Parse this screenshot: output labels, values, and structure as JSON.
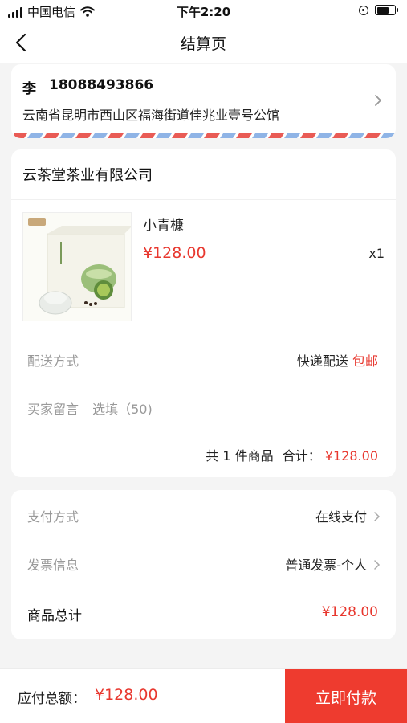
{
  "status_bar": {
    "carrier": "中国电信",
    "time": "下午2:20",
    "battery_level": 0.7
  },
  "nav": {
    "title": "结算页",
    "back_icon": "chevron-left-icon"
  },
  "address": {
    "name": "李",
    "phone": "18088493866",
    "detail": "云南省昆明市西山区福海街道佳兆业壹号公馆"
  },
  "order": {
    "store_name": "云茶堂茶业有限公司",
    "product": {
      "name": "小青槺",
      "price": "¥128.00",
      "quantity": "x1"
    },
    "delivery": {
      "label": "配送方式",
      "method": "快递配送",
      "fee": "包邮"
    },
    "message": {
      "label": "买家留言",
      "placeholder": "选填（50)"
    },
    "summary": {
      "count_text": "共 1 件商品",
      "total_label": "合计：",
      "total_value": "¥128.00"
    }
  },
  "payment": {
    "method_label": "支付方式",
    "method_value": "在线支付",
    "invoice_label": "发票信息",
    "invoice_value": "普通发票-个人",
    "goods_total_label": "商品总计",
    "goods_total_value": "¥128.00"
  },
  "bottom_bar": {
    "due_label": "应付总额：",
    "due_value": "¥128.00",
    "pay_button": "立即付款"
  },
  "colors": {
    "accent_red": "#ee3b2f",
    "price_red": "#e8372e",
    "stripe_blue": "#8fb4e6",
    "stripe_red": "#e95b55"
  }
}
